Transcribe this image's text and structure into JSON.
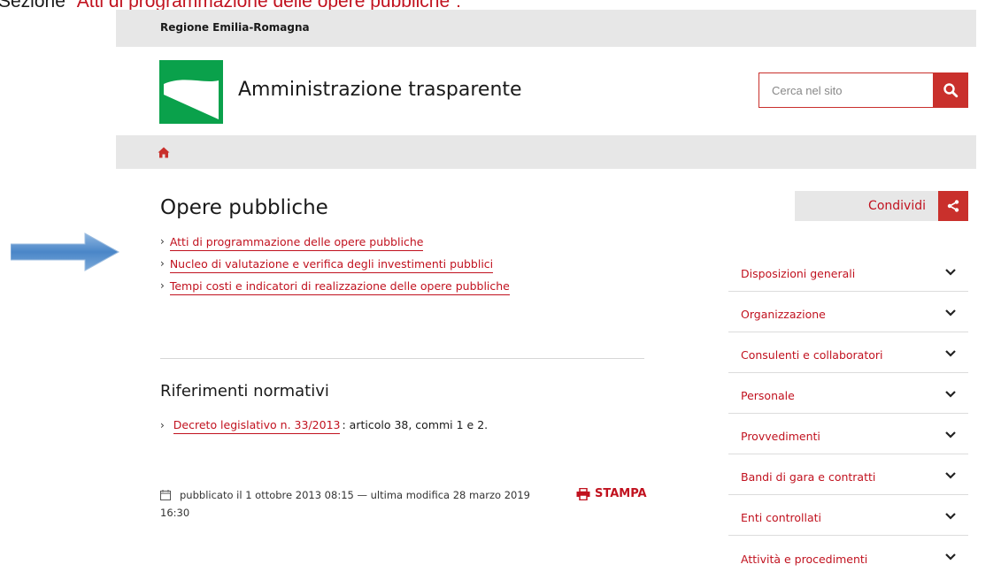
{
  "caption": {
    "prefix": "Sezione ",
    "highlight": "“Atti di programmazione delle opere pubbliche”:"
  },
  "header": {
    "region": "Regione Emilia-Romagna",
    "site_title": "Amministrazione trasparente",
    "search_placeholder": "Cerca nel sito",
    "search_icon": "search-icon",
    "logo_colors": {
      "green": "#0aa14b",
      "white": "#ffffff"
    }
  },
  "breadcrumb": {
    "home_icon": "home-icon"
  },
  "main": {
    "title": "Opere pubbliche",
    "links": [
      {
        "label": "Atti di programmazione delle opere pubbliche"
      },
      {
        "label": "Nucleo di valutazione e verifica degli investimenti pubblici"
      },
      {
        "label": "Tempi costi e indicatori di realizzazione delle opere pubbliche"
      }
    ],
    "riferimenti": {
      "title": "Riferimenti normativi",
      "link": "Decreto legislativo n. 33/2013",
      "rest": ": articolo 38, commi 1 e 2."
    },
    "meta_text": "pubblicato il 1 ottobre 2013 08:15 — ultima modifica 28 marzo 2019 16:30",
    "print_label": "STAMPA"
  },
  "share": {
    "label": "Condividi",
    "icon": "share-icon"
  },
  "sidebar": {
    "items": [
      {
        "label": "Disposizioni generali"
      },
      {
        "label": "Organizzazione"
      },
      {
        "label": "Consulenti e collaboratori"
      },
      {
        "label": "Personale"
      },
      {
        "label": "Provvedimenti"
      },
      {
        "label": "Bandi di gara e contratti"
      },
      {
        "label": "Enti controllati"
      },
      {
        "label": "Attività e procedimenti"
      }
    ]
  },
  "colors": {
    "accent": "#c9302c",
    "link": "#c1121f",
    "bar": "#e7e7e7",
    "arrow": "#4a86c8"
  }
}
